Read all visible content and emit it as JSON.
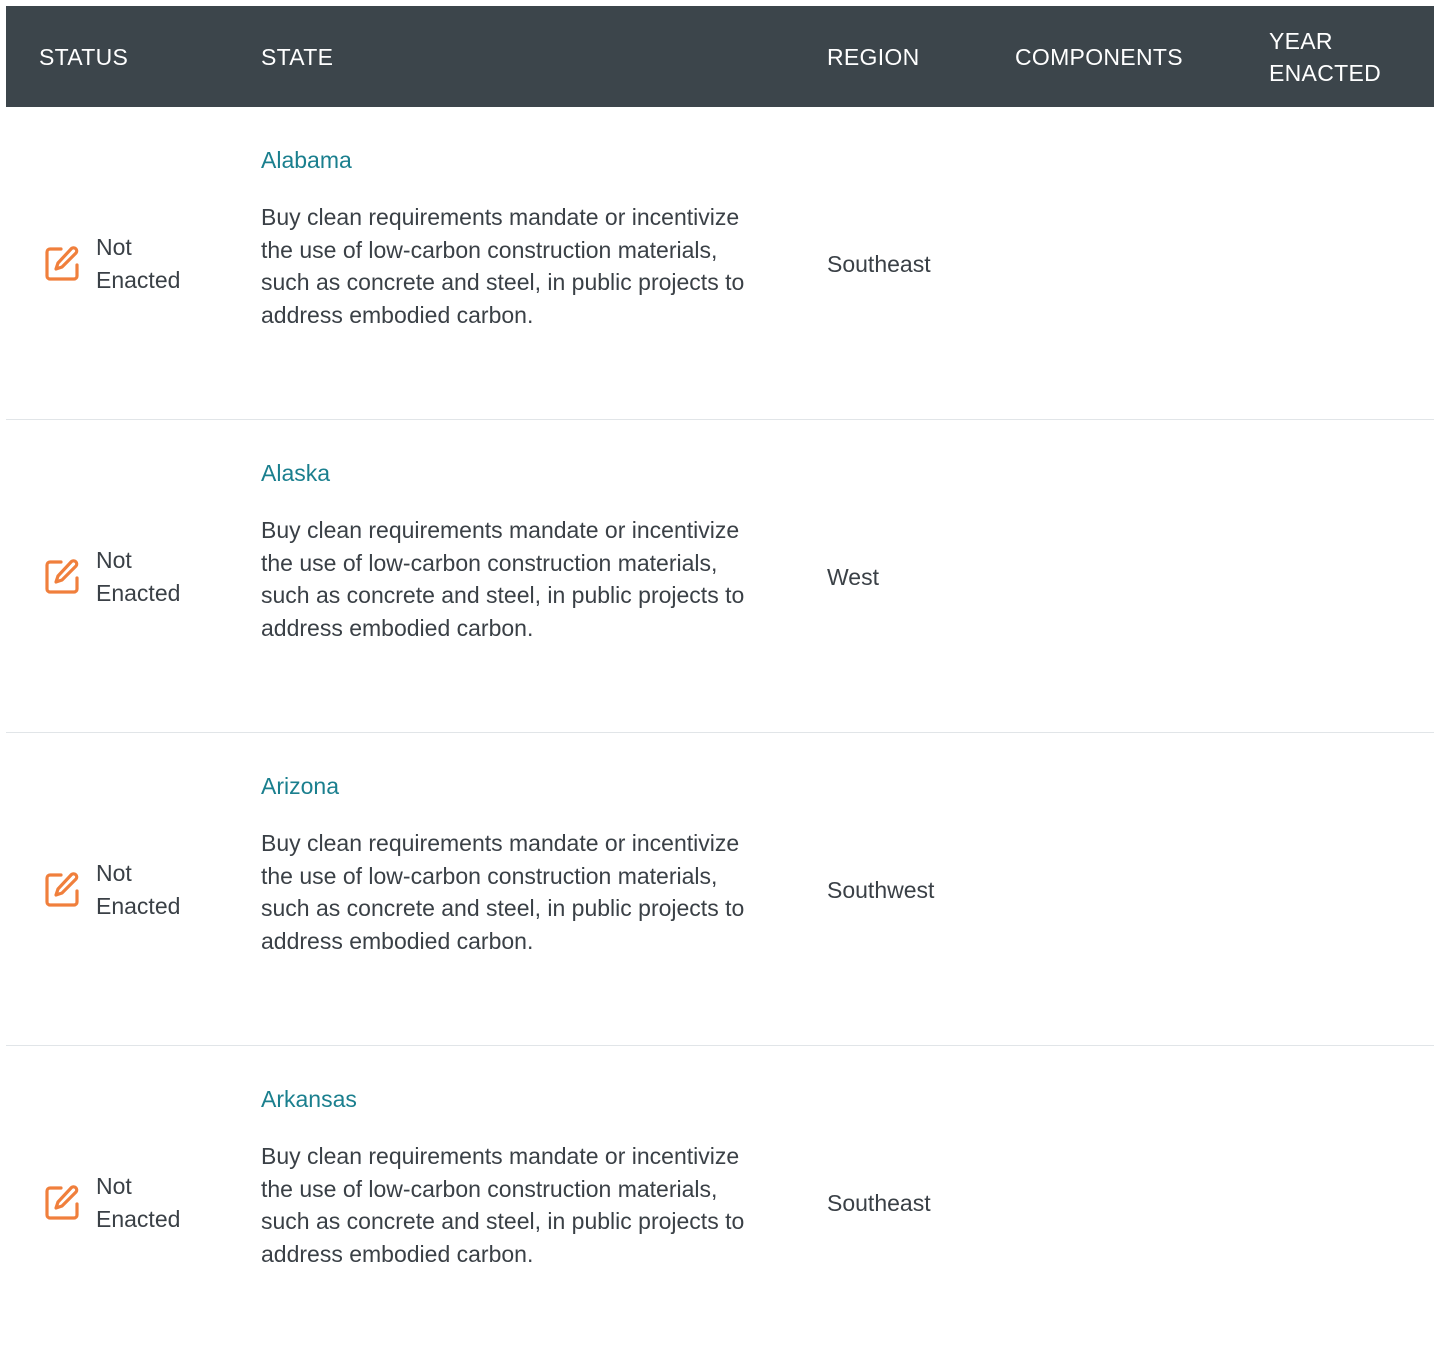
{
  "header": {
    "status": "STATUS",
    "state": "STATE",
    "region": "REGION",
    "components": "COMPONENTS",
    "year_enacted": "YEAR ENACTED"
  },
  "colors": {
    "header_bg": "#3c454b",
    "link": "#1a7f8e",
    "status_icon": "#f07f3c"
  },
  "rows": [
    {
      "status_icon": "edit-icon",
      "status": "Not Enacted",
      "state": "Alabama",
      "description": "Buy clean requirements mandate or incentivize the use of low-carbon construction materials, such as concrete and steel, in public projects to address embodied carbon.",
      "region": "Southeast",
      "components": "",
      "year_enacted": ""
    },
    {
      "status_icon": "edit-icon",
      "status": "Not Enacted",
      "state": "Alaska",
      "description": "Buy clean requirements mandate or incentivize the use of low-carbon construction materials, such as concrete and steel, in public projects to address embodied carbon.",
      "region": "West",
      "components": "",
      "year_enacted": ""
    },
    {
      "status_icon": "edit-icon",
      "status": "Not Enacted",
      "state": "Arizona",
      "description": "Buy clean requirements mandate or incentivize the use of low-carbon construction materials, such as concrete and steel, in public projects to address embodied carbon.",
      "region": "Southwest",
      "components": "",
      "year_enacted": ""
    },
    {
      "status_icon": "edit-icon",
      "status": "Not Enacted",
      "state": "Arkansas",
      "description": "Buy clean requirements mandate or incentivize the use of low-carbon construction materials, such as concrete and steel, in public projects to address embodied carbon.",
      "region": "Southeast",
      "components": "",
      "year_enacted": ""
    }
  ]
}
